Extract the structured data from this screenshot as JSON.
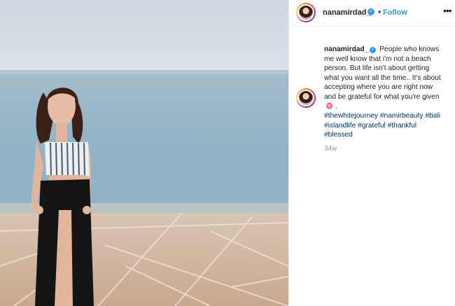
{
  "post": {
    "username": "nanamirdad_",
    "follow_label": "Follow",
    "more_icon": "•••",
    "verified_icon": "✓",
    "caption_lines": [
      "People who knows",
      "me well know that i'm not a beach",
      "person. But life isn't about getting",
      "what you want all the time.. It's about",
      "accepting where you are right now",
      "and be grateful for what you're given"
    ],
    "caption_end": ".",
    "hashtags": [
      "#thewhitejourney",
      "#namirbeauty",
      "#bali",
      "#islandlife",
      "#grateful",
      "#thankful",
      "#blessed"
    ],
    "timestamp": "34w"
  },
  "colors": {
    "link_blue": "#3897f0",
    "hashtag_blue": "#003569",
    "meta_gray": "#999999"
  },
  "icons": {
    "verified": "verified-badge-icon",
    "more": "more-options-icon",
    "emoji": "blossom-emoji-icon"
  }
}
